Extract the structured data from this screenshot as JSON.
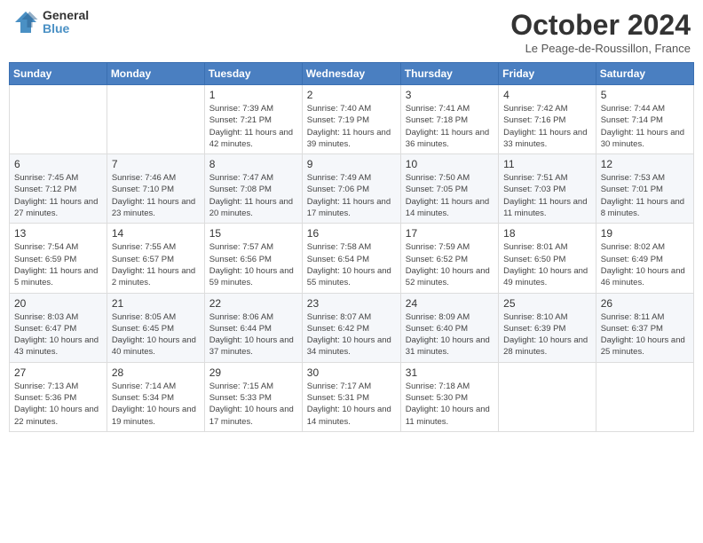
{
  "header": {
    "logo_line1": "General",
    "logo_line2": "Blue",
    "month_title": "October 2024",
    "location": "Le Peage-de-Roussillon, France"
  },
  "weekdays": [
    "Sunday",
    "Monday",
    "Tuesday",
    "Wednesday",
    "Thursday",
    "Friday",
    "Saturday"
  ],
  "weeks": [
    [
      {
        "day": "",
        "sunrise": "",
        "sunset": "",
        "daylight": ""
      },
      {
        "day": "",
        "sunrise": "",
        "sunset": "",
        "daylight": ""
      },
      {
        "day": "1",
        "sunrise": "Sunrise: 7:39 AM",
        "sunset": "Sunset: 7:21 PM",
        "daylight": "Daylight: 11 hours and 42 minutes."
      },
      {
        "day": "2",
        "sunrise": "Sunrise: 7:40 AM",
        "sunset": "Sunset: 7:19 PM",
        "daylight": "Daylight: 11 hours and 39 minutes."
      },
      {
        "day": "3",
        "sunrise": "Sunrise: 7:41 AM",
        "sunset": "Sunset: 7:18 PM",
        "daylight": "Daylight: 11 hours and 36 minutes."
      },
      {
        "day": "4",
        "sunrise": "Sunrise: 7:42 AM",
        "sunset": "Sunset: 7:16 PM",
        "daylight": "Daylight: 11 hours and 33 minutes."
      },
      {
        "day": "5",
        "sunrise": "Sunrise: 7:44 AM",
        "sunset": "Sunset: 7:14 PM",
        "daylight": "Daylight: 11 hours and 30 minutes."
      }
    ],
    [
      {
        "day": "6",
        "sunrise": "Sunrise: 7:45 AM",
        "sunset": "Sunset: 7:12 PM",
        "daylight": "Daylight: 11 hours and 27 minutes."
      },
      {
        "day": "7",
        "sunrise": "Sunrise: 7:46 AM",
        "sunset": "Sunset: 7:10 PM",
        "daylight": "Daylight: 11 hours and 23 minutes."
      },
      {
        "day": "8",
        "sunrise": "Sunrise: 7:47 AM",
        "sunset": "Sunset: 7:08 PM",
        "daylight": "Daylight: 11 hours and 20 minutes."
      },
      {
        "day": "9",
        "sunrise": "Sunrise: 7:49 AM",
        "sunset": "Sunset: 7:06 PM",
        "daylight": "Daylight: 11 hours and 17 minutes."
      },
      {
        "day": "10",
        "sunrise": "Sunrise: 7:50 AM",
        "sunset": "Sunset: 7:05 PM",
        "daylight": "Daylight: 11 hours and 14 minutes."
      },
      {
        "day": "11",
        "sunrise": "Sunrise: 7:51 AM",
        "sunset": "Sunset: 7:03 PM",
        "daylight": "Daylight: 11 hours and 11 minutes."
      },
      {
        "day": "12",
        "sunrise": "Sunrise: 7:53 AM",
        "sunset": "Sunset: 7:01 PM",
        "daylight": "Daylight: 11 hours and 8 minutes."
      }
    ],
    [
      {
        "day": "13",
        "sunrise": "Sunrise: 7:54 AM",
        "sunset": "Sunset: 6:59 PM",
        "daylight": "Daylight: 11 hours and 5 minutes."
      },
      {
        "day": "14",
        "sunrise": "Sunrise: 7:55 AM",
        "sunset": "Sunset: 6:57 PM",
        "daylight": "Daylight: 11 hours and 2 minutes."
      },
      {
        "day": "15",
        "sunrise": "Sunrise: 7:57 AM",
        "sunset": "Sunset: 6:56 PM",
        "daylight": "Daylight: 10 hours and 59 minutes."
      },
      {
        "day": "16",
        "sunrise": "Sunrise: 7:58 AM",
        "sunset": "Sunset: 6:54 PM",
        "daylight": "Daylight: 10 hours and 55 minutes."
      },
      {
        "day": "17",
        "sunrise": "Sunrise: 7:59 AM",
        "sunset": "Sunset: 6:52 PM",
        "daylight": "Daylight: 10 hours and 52 minutes."
      },
      {
        "day": "18",
        "sunrise": "Sunrise: 8:01 AM",
        "sunset": "Sunset: 6:50 PM",
        "daylight": "Daylight: 10 hours and 49 minutes."
      },
      {
        "day": "19",
        "sunrise": "Sunrise: 8:02 AM",
        "sunset": "Sunset: 6:49 PM",
        "daylight": "Daylight: 10 hours and 46 minutes."
      }
    ],
    [
      {
        "day": "20",
        "sunrise": "Sunrise: 8:03 AM",
        "sunset": "Sunset: 6:47 PM",
        "daylight": "Daylight: 10 hours and 43 minutes."
      },
      {
        "day": "21",
        "sunrise": "Sunrise: 8:05 AM",
        "sunset": "Sunset: 6:45 PM",
        "daylight": "Daylight: 10 hours and 40 minutes."
      },
      {
        "day": "22",
        "sunrise": "Sunrise: 8:06 AM",
        "sunset": "Sunset: 6:44 PM",
        "daylight": "Daylight: 10 hours and 37 minutes."
      },
      {
        "day": "23",
        "sunrise": "Sunrise: 8:07 AM",
        "sunset": "Sunset: 6:42 PM",
        "daylight": "Daylight: 10 hours and 34 minutes."
      },
      {
        "day": "24",
        "sunrise": "Sunrise: 8:09 AM",
        "sunset": "Sunset: 6:40 PM",
        "daylight": "Daylight: 10 hours and 31 minutes."
      },
      {
        "day": "25",
        "sunrise": "Sunrise: 8:10 AM",
        "sunset": "Sunset: 6:39 PM",
        "daylight": "Daylight: 10 hours and 28 minutes."
      },
      {
        "day": "26",
        "sunrise": "Sunrise: 8:11 AM",
        "sunset": "Sunset: 6:37 PM",
        "daylight": "Daylight: 10 hours and 25 minutes."
      }
    ],
    [
      {
        "day": "27",
        "sunrise": "Sunrise: 7:13 AM",
        "sunset": "Sunset: 5:36 PM",
        "daylight": "Daylight: 10 hours and 22 minutes."
      },
      {
        "day": "28",
        "sunrise": "Sunrise: 7:14 AM",
        "sunset": "Sunset: 5:34 PM",
        "daylight": "Daylight: 10 hours and 19 minutes."
      },
      {
        "day": "29",
        "sunrise": "Sunrise: 7:15 AM",
        "sunset": "Sunset: 5:33 PM",
        "daylight": "Daylight: 10 hours and 17 minutes."
      },
      {
        "day": "30",
        "sunrise": "Sunrise: 7:17 AM",
        "sunset": "Sunset: 5:31 PM",
        "daylight": "Daylight: 10 hours and 14 minutes."
      },
      {
        "day": "31",
        "sunrise": "Sunrise: 7:18 AM",
        "sunset": "Sunset: 5:30 PM",
        "daylight": "Daylight: 10 hours and 11 minutes."
      },
      {
        "day": "",
        "sunrise": "",
        "sunset": "",
        "daylight": ""
      },
      {
        "day": "",
        "sunrise": "",
        "sunset": "",
        "daylight": ""
      }
    ]
  ]
}
